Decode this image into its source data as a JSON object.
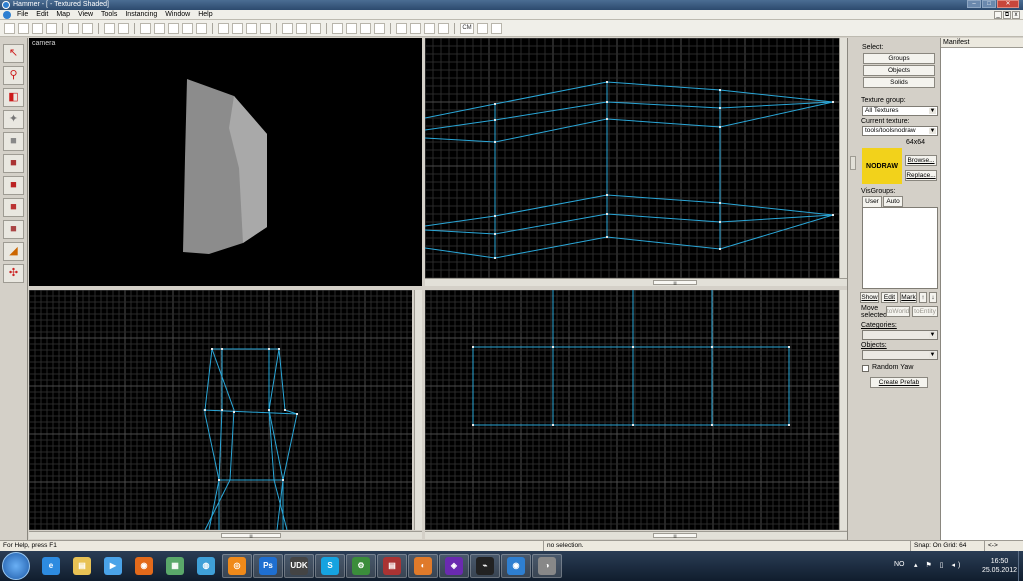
{
  "window": {
    "title": "Hammer - [ - Textured Shaded]",
    "controls": {
      "minimize": "–",
      "maximize": "□",
      "close": "✕"
    },
    "mdi_controls": {
      "minimize": "_",
      "restore": "⧉",
      "close": "x"
    }
  },
  "menu": [
    "File",
    "Edit",
    "Map",
    "View",
    "Tools",
    "Instancing",
    "Window",
    "Help"
  ],
  "toolbar": {
    "buttons": [
      "grid-toggle",
      "grid-3d",
      "grid-smaller",
      "grid-larger",
      "load-window",
      "save-window",
      "undo",
      "redo",
      "carve",
      "group",
      "ungroup",
      "hide",
      "show",
      "texture-lock",
      "cut",
      "copy",
      "paste",
      "toggle-helpers",
      "toggle-models",
      "select-box",
      "select-objects",
      "flip-h",
      "flip-v",
      "run-map",
      "cordon",
      "split",
      "entity-report",
      "check-problems",
      "cubemaps",
      "run-map-2",
      "tools-extra"
    ],
    "cm_label": "CM"
  },
  "palette": {
    "tools": [
      {
        "name": "selection-tool",
        "glyph": "↖",
        "color": "#cc1a1a"
      },
      {
        "name": "magnify-tool",
        "glyph": "⚲",
        "color": "#cc1a1a"
      },
      {
        "name": "camera-tool",
        "glyph": "◧",
        "color": "#cc1a1a"
      },
      {
        "name": "entity-tool",
        "glyph": "✦",
        "color": "#777"
      },
      {
        "name": "block-tool",
        "glyph": "■",
        "color": "#888"
      },
      {
        "name": "texture-tool",
        "glyph": "■",
        "color": "#a33"
      },
      {
        "name": "apply-texture-tool",
        "glyph": "■",
        "color": "#b22"
      },
      {
        "name": "decal-tool",
        "glyph": "■",
        "color": "#b33"
      },
      {
        "name": "overlay-tool",
        "glyph": "■",
        "color": "#a44"
      },
      {
        "name": "clipping-tool",
        "glyph": "◢",
        "color": "#c60"
      },
      {
        "name": "vertex-tool",
        "glyph": "✣",
        "color": "#c22"
      }
    ]
  },
  "viewports": {
    "camera": {
      "label": "camera"
    },
    "top_right": {
      "label": ""
    },
    "bottom_left": {
      "label": ""
    },
    "bottom_right": {
      "label": ""
    },
    "scroll_thumb": "|||"
  },
  "panel": {
    "select_label": "Select:",
    "groups": "Groups",
    "objects": "Objects",
    "solids": "Solids",
    "texture_group_label": "Texture group:",
    "texture_group_value": "All Textures",
    "current_texture_label": "Current texture:",
    "current_texture_value": "tools/toolsnodraw",
    "texture_size": "64x64",
    "texture_preview_text": "NODRAW",
    "texture_preview_color": "#f2d21b",
    "browse": "Browse...",
    "replace": "Replace...",
    "visgroups_label": "VisGroups:",
    "tab_user": "User",
    "tab_auto": "Auto",
    "show": "Show",
    "edit": "Edit",
    "mark": "Mark",
    "up": "↑",
    "down": "↓",
    "move_selected": "Move selected:",
    "to_world": "toWorld",
    "to_entity": "toEntity",
    "categories_label": "Categories:",
    "objects_label": "Objects:",
    "random_yaw": "Random Yaw",
    "create_prefab": "Create Prefab"
  },
  "manifest": {
    "title": "Manifest"
  },
  "statusbar": {
    "help": "For Help, press F1",
    "selection": "no selection.",
    "snap": "Snap: On Grid: 64",
    "extra": "<->"
  },
  "taskbar": {
    "apps": [
      {
        "name": "ie",
        "glyph": "e",
        "color": "#2d8be0"
      },
      {
        "name": "explorer",
        "glyph": "▤",
        "color": "#e8c255"
      },
      {
        "name": "media",
        "glyph": "▶",
        "color": "#4aa3e8"
      },
      {
        "name": "firefox",
        "glyph": "◉",
        "color": "#e36a1b"
      },
      {
        "name": "image",
        "glyph": "▦",
        "color": "#5aa86a"
      },
      {
        "name": "globe",
        "glyph": "◍",
        "color": "#3fa0d8"
      },
      {
        "name": "app-orange",
        "glyph": "◎",
        "color": "#f08a1a"
      },
      {
        "name": "photoshop",
        "glyph": "Ps",
        "color": "#1f6fd1"
      },
      {
        "name": "udk",
        "glyph": "UDK",
        "color": "#444"
      },
      {
        "name": "skype",
        "glyph": "S",
        "color": "#16a3e0"
      },
      {
        "name": "steam",
        "glyph": "⚙",
        "color": "#3b8d3b"
      },
      {
        "name": "app-grid",
        "glyph": "▤",
        "color": "#a33"
      },
      {
        "name": "app-swirl",
        "glyph": "◐",
        "color": "#e07a2a"
      },
      {
        "name": "app-purple",
        "glyph": "◈",
        "color": "#6a2ab0"
      },
      {
        "name": "steam-2",
        "glyph": "⌁",
        "color": "#222"
      },
      {
        "name": "hammer",
        "glyph": "◉",
        "color": "#2e7fd1"
      },
      {
        "name": "app-last",
        "glyph": "◑",
        "color": "#888"
      }
    ],
    "lang": "NO",
    "tray_icons": "▴ ⚑ ▯ ◂)",
    "time": "16:50",
    "date": "25.05.2012"
  }
}
